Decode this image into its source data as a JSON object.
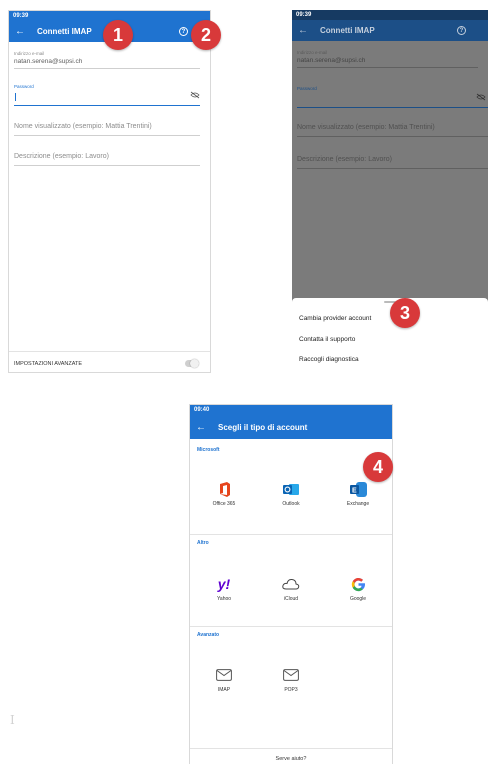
{
  "colors": {
    "accent": "#1f73d0",
    "badge": "#d8393a",
    "dim_accent": "#1c4f87"
  },
  "screen1": {
    "time": "09:39",
    "title": "Connetti IMAP",
    "email_label": "Indirizzo e-mail",
    "email_value": "natan.serena@supsi.ch",
    "password_label": "Password",
    "display_name_placeholder": "Nome visualizzato (esempio: Mattia Trentini)",
    "description_placeholder": "Descrizione (esempio: Lavoro)",
    "advanced_settings": "IMPOSTAZIONI AVANZATE",
    "advanced_toggle_on": false
  },
  "screen2": {
    "time": "09:39",
    "title": "Connetti IMAP",
    "email_label": "Indirizzo e-mail",
    "email_value": "natan.serena@supsi.ch",
    "password_label": "Password",
    "display_name_placeholder": "Nome visualizzato (esempio: Mattia Trentini)",
    "description_placeholder": "Descrizione (esempio: Lavoro)",
    "menu": [
      "Cambia provider account",
      "Contatta il supporto",
      "Raccogli diagnostica"
    ]
  },
  "screen3": {
    "time": "09:40",
    "title": "Scegli il tipo di account",
    "sections": {
      "microsoft": "Microsoft",
      "other": "Altro",
      "advanced": "Avanzato"
    },
    "microsoft_tiles": [
      "Office 365",
      "Outlook",
      "Exchange"
    ],
    "other_tiles": [
      "Yahoo",
      "iCloud",
      "Google"
    ],
    "advanced_tiles": [
      "IMAP",
      "POP3"
    ],
    "footer": "Serve aiuto?"
  },
  "badges": [
    "1",
    "2",
    "3",
    "4"
  ],
  "icons": [
    "back-arrow-icon",
    "help-icon",
    "eye-off-icon",
    "office-icon",
    "outlook-icon",
    "exchange-icon",
    "yahoo-icon",
    "cloud-icon",
    "google-icon",
    "mail-icon"
  ]
}
